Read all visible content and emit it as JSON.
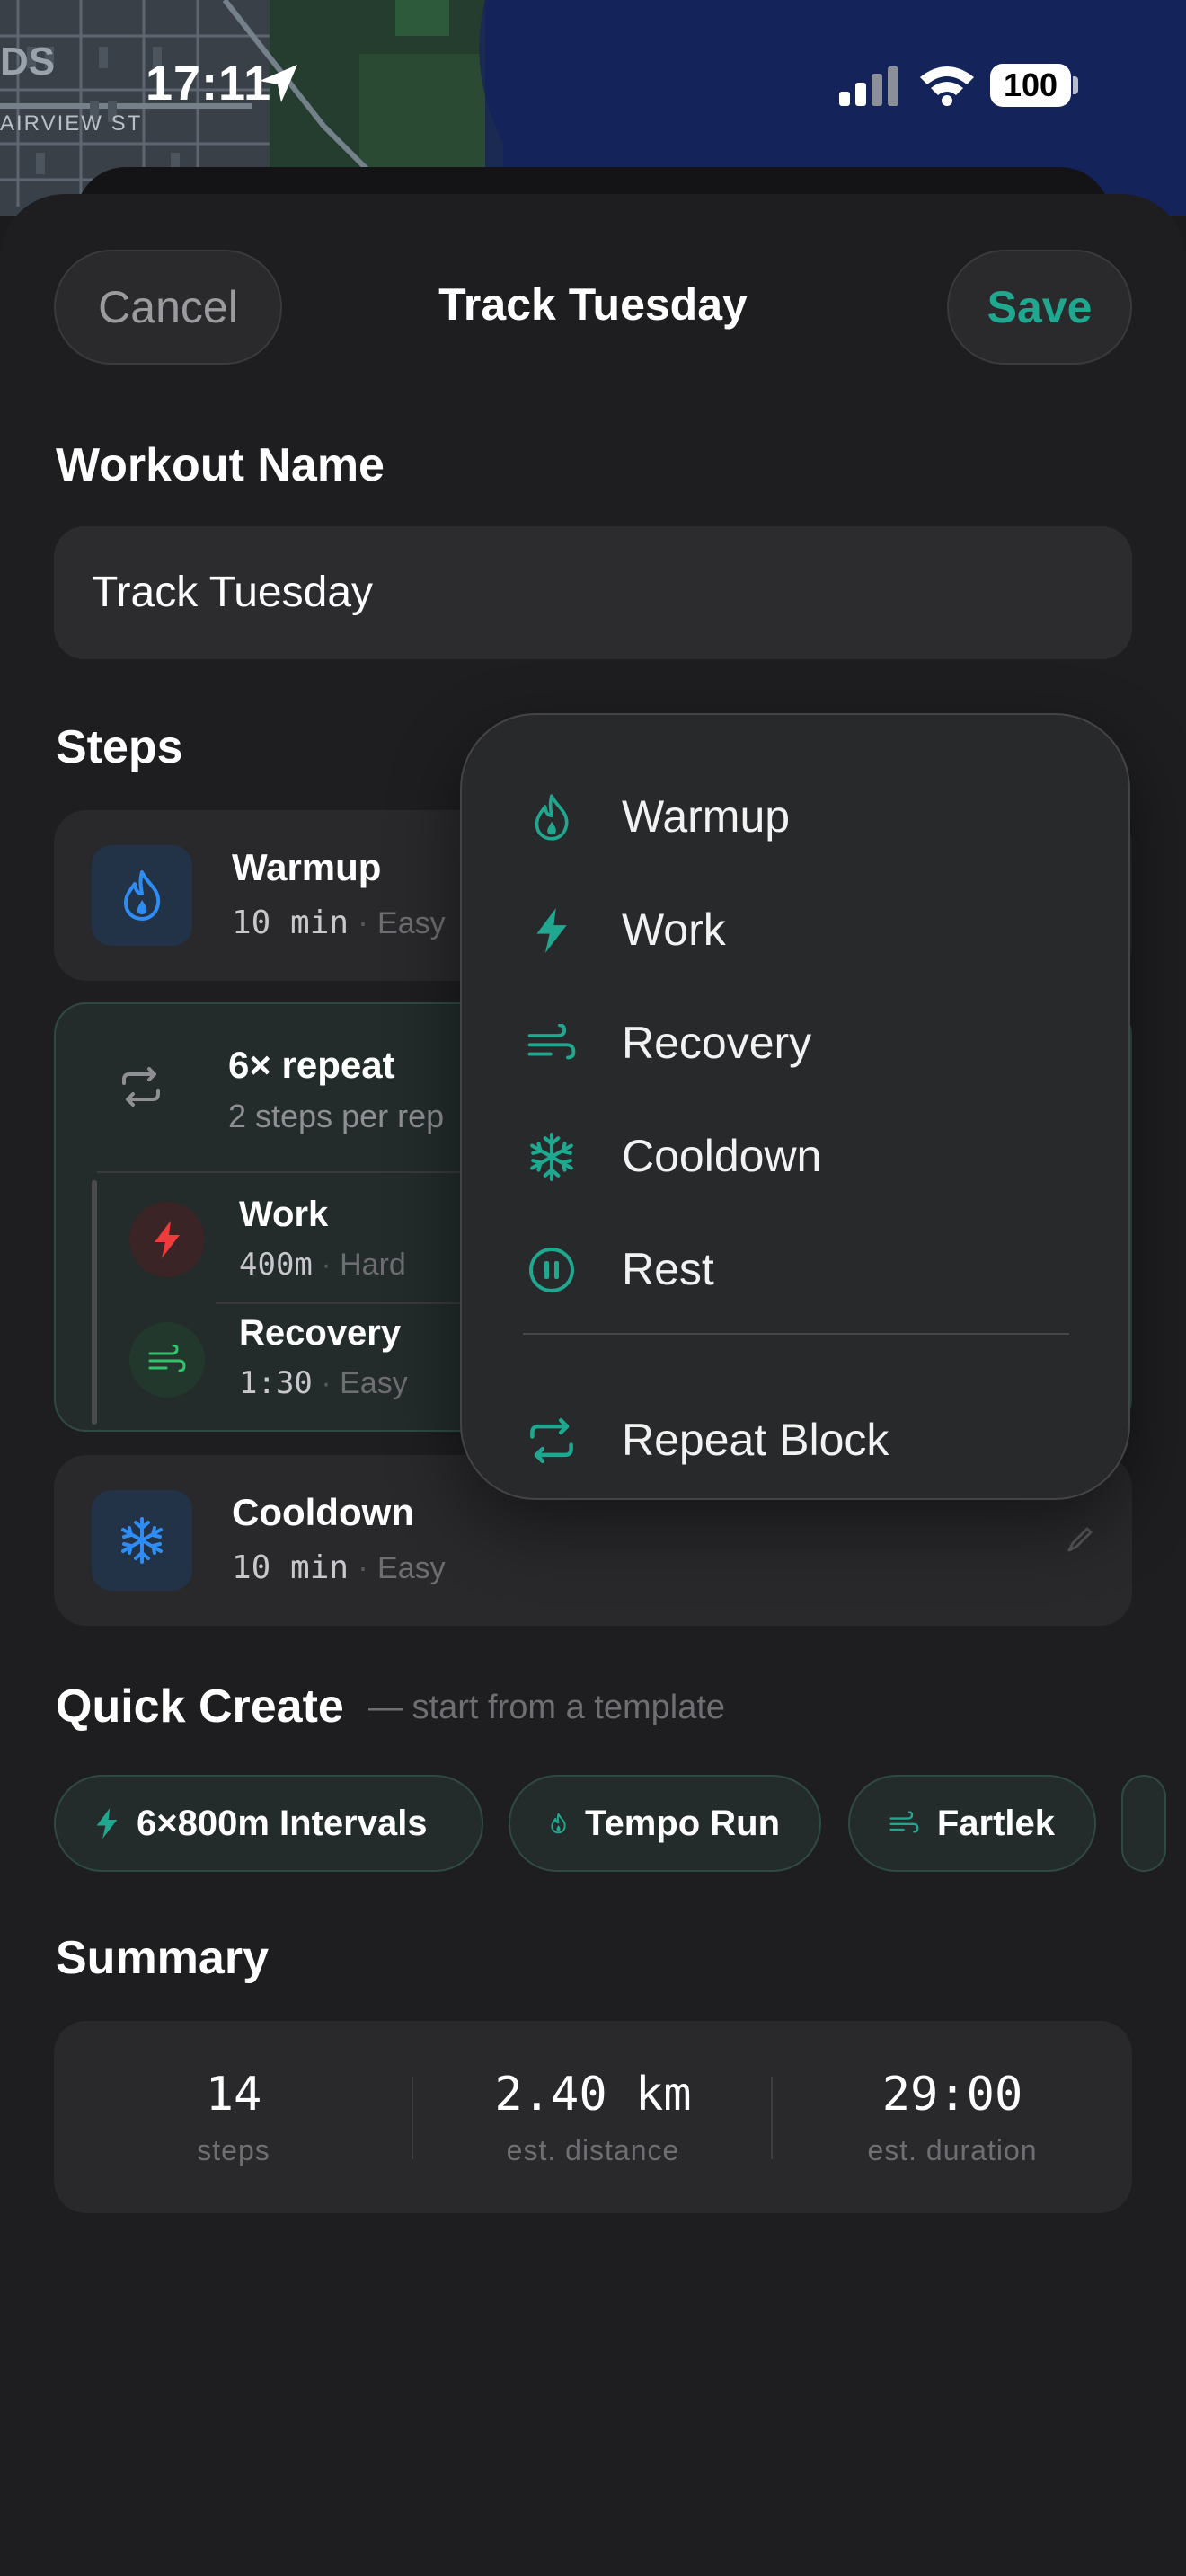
{
  "status_bar": {
    "time": "17:11",
    "battery": "100"
  },
  "map": {
    "street": "AIRVIEW ST",
    "corner_text": "DS"
  },
  "header": {
    "cancel_label": "Cancel",
    "title": "Track Tuesday",
    "save_label": "Save"
  },
  "workout_name": {
    "label": "Workout Name",
    "value": "Track Tuesday"
  },
  "steps": {
    "label": "Steps",
    "warmup": {
      "title": "Warmup",
      "duration": "10 min",
      "intensity": "Easy"
    },
    "repeat": {
      "title": "6× repeat",
      "subtitle": "2 steps per rep",
      "children": [
        {
          "title": "Work",
          "duration": "400m",
          "intensity": "Hard"
        },
        {
          "title": "Recovery",
          "duration": "1:30",
          "intensity": "Easy"
        }
      ]
    },
    "cooldown": {
      "title": "Cooldown",
      "duration": "10 min",
      "intensity": "Easy"
    }
  },
  "add_menu": {
    "items": [
      {
        "label": "Warmup",
        "icon": "flame-icon"
      },
      {
        "label": "Work",
        "icon": "bolt-icon"
      },
      {
        "label": "Recovery",
        "icon": "wind-icon"
      },
      {
        "label": "Cooldown",
        "icon": "snowflake-icon"
      },
      {
        "label": "Rest",
        "icon": "pause-icon"
      }
    ],
    "repeat_block": {
      "label": "Repeat Block",
      "icon": "repeat-icon"
    }
  },
  "quick_create": {
    "label": "Quick Create",
    "subtitle": "— start from a template",
    "chips": [
      {
        "label": "6×800m Intervals",
        "icon": "bolt-icon"
      },
      {
        "label": "Tempo Run",
        "icon": "flame-icon"
      },
      {
        "label": "Fartlek",
        "icon": "wind-icon"
      }
    ]
  },
  "summary": {
    "label": "Summary",
    "steps": {
      "value": "14",
      "label": "steps"
    },
    "distance": {
      "value": "2.40 km",
      "label": "est. distance"
    },
    "duration": {
      "value": "29:00",
      "label": "est. duration"
    }
  },
  "colors": {
    "accent": "#1fa88f",
    "warmup": "#2e8df5",
    "work": "#ef3b3b",
    "recovery": "#31c46b",
    "cooldown": "#2e8df5"
  }
}
